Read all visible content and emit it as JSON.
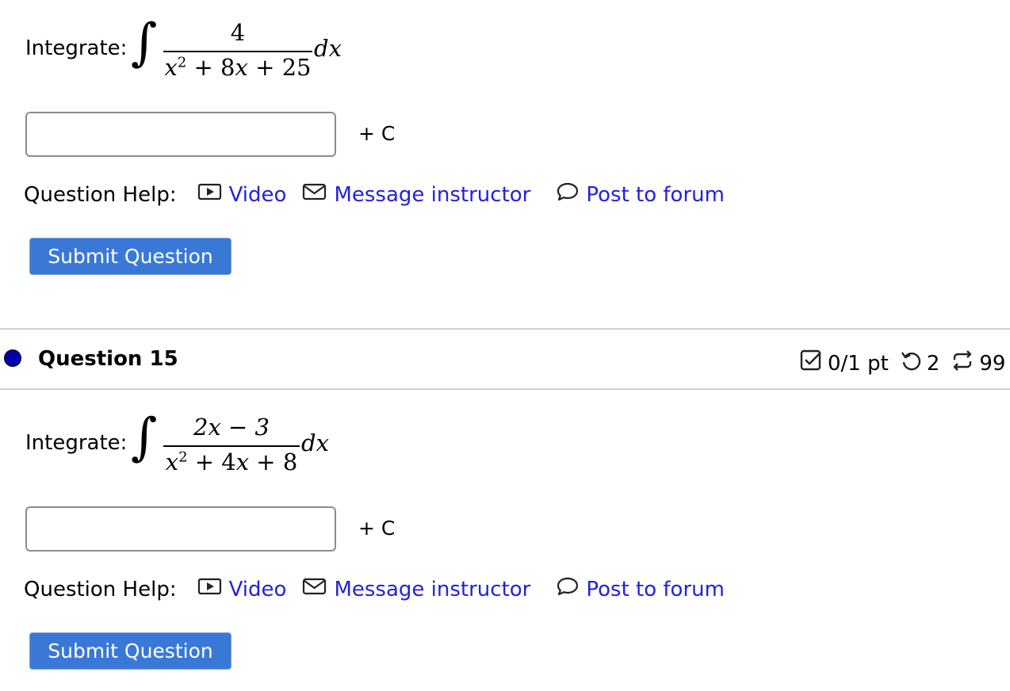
{
  "questions": [
    {
      "prompt": "Integrate:",
      "integrand": {
        "numerator": "4",
        "denominator_parts": [
          "x",
          "2",
          " + 8",
          "x",
          " + 25"
        ],
        "differential": "dx"
      },
      "input_value": "",
      "suffix": "+ C",
      "help_label": "Question Help:",
      "help_links": {
        "video": "Video",
        "message": "Message instructor",
        "forum": "Post to forum"
      },
      "submit_label": "Submit Question"
    },
    {
      "prompt": "Integrate:",
      "integrand": {
        "numerator": "2x − 3",
        "denominator_parts": [
          "x",
          "2",
          " + 4",
          "x",
          " + 8"
        ],
        "differential": "dx"
      },
      "input_value": "",
      "suffix": "+ C",
      "help_label": "Question Help:",
      "help_links": {
        "video": "Video",
        "message": "Message instructor",
        "forum": "Post to forum"
      },
      "submit_label": "Submit Question"
    }
  ],
  "question_header": {
    "title": "Question 15",
    "points": "0/1 pt",
    "retries": "2",
    "attempts": "99"
  },
  "colors": {
    "link": "#2222dd",
    "button": "#3a78d8",
    "status_dot": "#0000aa"
  },
  "icons": {
    "video": "video-play-icon",
    "message": "envelope-icon",
    "forum": "speech-bubble-icon",
    "points": "checkbox-icon",
    "retries": "undo-icon",
    "attempts": "repeat-icon"
  }
}
